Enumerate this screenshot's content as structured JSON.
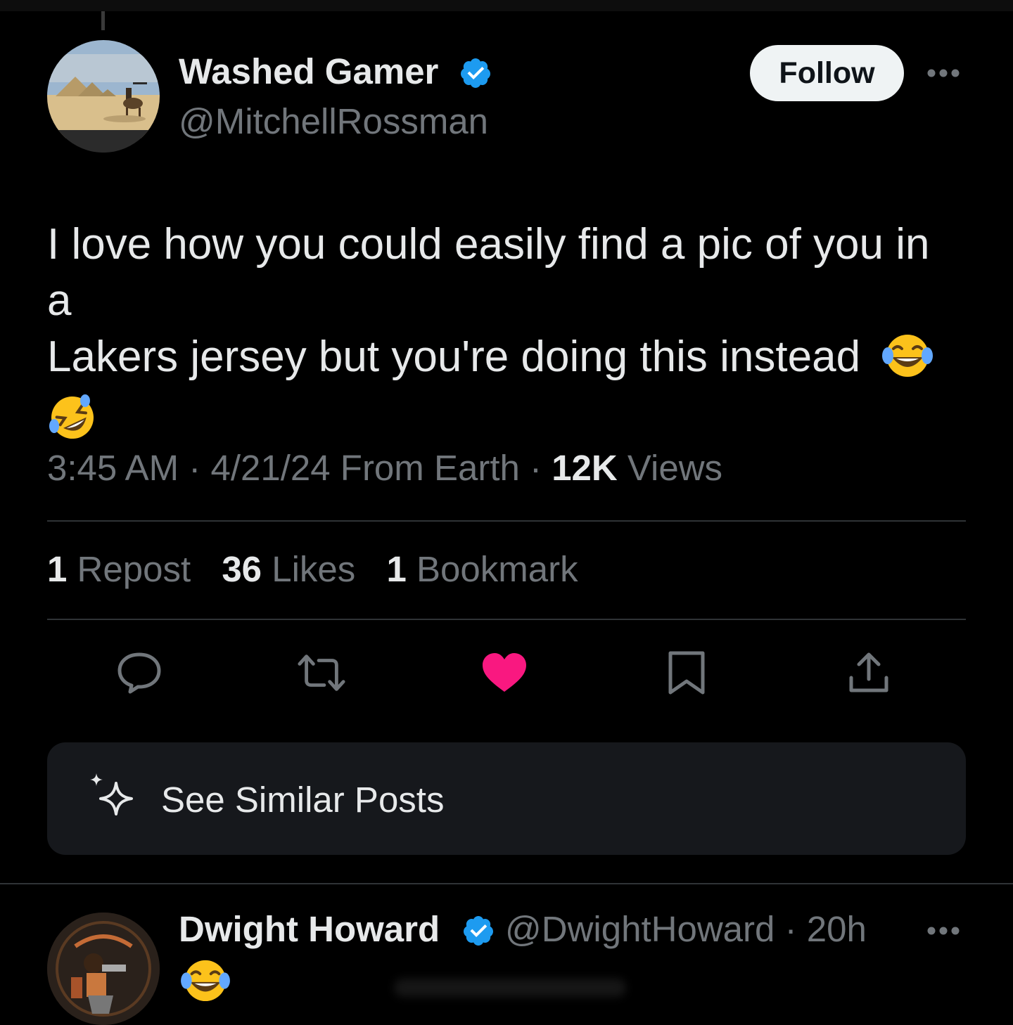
{
  "post": {
    "author_name": "Washed Gamer",
    "author_handle": "@MitchellRossman",
    "follow_label": "Follow",
    "text_line1": "I love how you could easily find a pic of you in a",
    "text_line2": "Lakers jersey but you're doing this instead",
    "emojis": [
      "face-with-tears-of-joy",
      "rolling-on-the-floor-laughing"
    ],
    "time": "3:45 AM",
    "dot": "·",
    "date": "4/21/24",
    "location": "From Earth",
    "views_count": "12K",
    "views_label": "Views",
    "reposts_count": "1",
    "reposts_label": "Repost",
    "likes_count": "36",
    "likes_label": "Likes",
    "bookmarks_count": "1",
    "bookmarks_label": "Bookmark",
    "liked": true
  },
  "actions": [
    "reply-icon",
    "repost-icon",
    "like-icon",
    "bookmark-icon",
    "share-icon"
  ],
  "similar": {
    "label": "See Similar Posts"
  },
  "reply": {
    "author_name": "Dwight Howard",
    "author_handle": "@DwightHoward",
    "dot": "·",
    "age": "20h"
  },
  "colors": {
    "background": "#000000",
    "text_primary": "#e7e9ea",
    "text_secondary": "#71767b",
    "verified": "#1d9bf0",
    "like": "#f91880",
    "follow_bg": "#eff3f4",
    "divider": "#2f3336",
    "card_bg": "#16181c"
  }
}
